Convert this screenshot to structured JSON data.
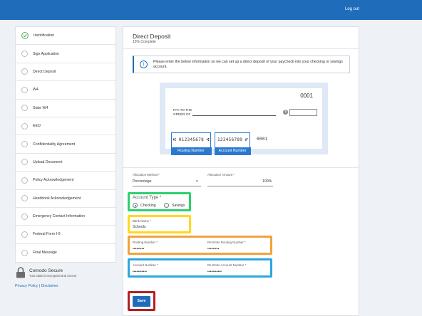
{
  "header": {
    "logout_label": "Log out"
  },
  "sidebar": {
    "items": [
      {
        "label": "Identification",
        "status": "complete"
      },
      {
        "label": "Sign Application",
        "status": "pending"
      },
      {
        "label": "Direct Deposit",
        "status": "pending"
      },
      {
        "label": "W4",
        "status": "pending"
      },
      {
        "label": "State W4",
        "status": "pending"
      },
      {
        "label": "EEO",
        "status": "pending"
      },
      {
        "label": "Confidentiality Agreement",
        "status": "pending"
      },
      {
        "label": "Upload Document",
        "status": "pending"
      },
      {
        "label": "Policy Acknowledgement",
        "status": "pending"
      },
      {
        "label": "Handbook Acknowledgement",
        "status": "pending"
      },
      {
        "label": "Emergency Contact Information",
        "status": "pending"
      },
      {
        "label": "Federal Form I-9",
        "status": "pending"
      },
      {
        "label": "Final Message",
        "status": "pending"
      }
    ]
  },
  "secure": {
    "title": "Comodo Secure",
    "subtitle": "Your data is encrypted and secure"
  },
  "footer": {
    "privacy_label": "Privacy Policy",
    "separator": "|",
    "disclaimer_label": "Disclaimer"
  },
  "main": {
    "title": "Direct Deposit",
    "progress_text": "15% Complete",
    "progress_percent": 15,
    "info_text": "Please enter the below information so we can set up a direct deposit of your paycheck into your checking or savings account.",
    "check": {
      "number": "0001",
      "pay_to_line1": "PAY TO THE",
      "pay_to_line2": "ORDER OF",
      "dollar_symbol": "$",
      "routing_micr": "⑆ 012345678 ⑆",
      "account_micr": "123456789 ⑈",
      "check_micr": "0001",
      "routing_label": "Routing Number",
      "account_label": "Account Number"
    },
    "form": {
      "allocation_method_label": "Allocation Method *",
      "allocation_method_value": "Percentage",
      "allocation_amount_label": "Allocation Amount *",
      "allocation_amount_value": "100%",
      "account_type_label": "Account Type *",
      "account_type_options": [
        "Checking",
        "Savings"
      ],
      "account_type_selected": "Checking",
      "bank_name_label": "Bank Name *",
      "bank_name_value": "Schools",
      "routing_number_label": "Routing Number *",
      "routing_number_value": "•••••••••",
      "reenter_routing_label": "Re-Enter Routing Number *",
      "reenter_routing_value": "•••••••••",
      "account_number_label": "Account Number *",
      "account_number_value": "•••••••••••",
      "reenter_account_label": "Re-Enter Account Number *",
      "reenter_account_value": "•••••••••••"
    },
    "save_label": "Save"
  },
  "colors": {
    "primary": "#1f6dba",
    "highlight_green": "#2dcf6e",
    "highlight_yellow": "#ffd91f",
    "highlight_orange": "#f4a23b",
    "highlight_cyan": "#2aa7df",
    "highlight_red": "#b51f24"
  }
}
